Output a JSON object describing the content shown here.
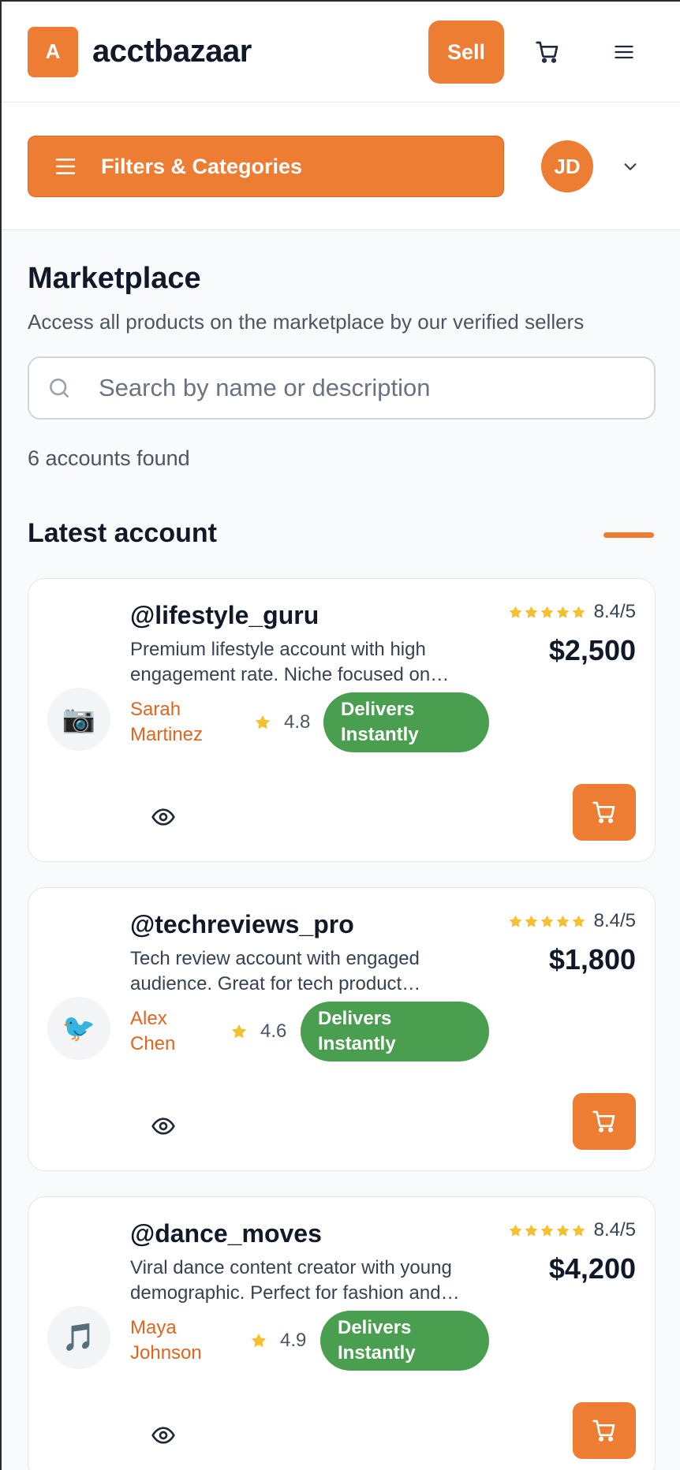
{
  "header": {
    "logo_letter": "A",
    "brand": "acctbazaar",
    "sell_label": "Sell"
  },
  "filterbar": {
    "filters_label": "Filters & Categories",
    "avatar_initials": "JD"
  },
  "main": {
    "title": "Marketplace",
    "subtitle": "Access all products on the marketplace by our verified sellers",
    "search_placeholder": "Search by name or description",
    "count_text": "6 accounts found",
    "section_title": "Latest account"
  },
  "listings": [
    {
      "handle": "@lifestyle_guru",
      "description": "Premium lifestyle account with high engagement rate. Niche focused on…",
      "rating": "8.4/5",
      "price": "$2,500",
      "emoji": "📷",
      "seller": "Sarah Martinez",
      "seller_line1": "Sarah",
      "seller_line2": "Martinez",
      "seller_rating": "4.8",
      "badge": "Delivers Instantly"
    },
    {
      "handle": "@techreviews_pro",
      "description": "Tech review account with engaged audience. Great for tech product…",
      "rating": "8.4/5",
      "price": "$1,800",
      "emoji": "🐦",
      "seller": "Alex Chen",
      "seller_line1": "Alex",
      "seller_line2": "Chen",
      "seller_rating": "4.6",
      "badge": "Delivers Instantly"
    },
    {
      "handle": "@dance_moves",
      "description": "Viral dance content creator with young demographic. Perfect for fashion and…",
      "rating": "8.4/5",
      "price": "$4,200",
      "emoji": "🎵",
      "seller": "Maya Johnson",
      "seller_line1": "Maya",
      "seller_line2": "Johnson",
      "seller_rating": "4.9",
      "badge": "Delivers Instantly"
    }
  ],
  "colors": {
    "accent": "#ed7d32",
    "seller_name": "#e0661f",
    "badge_green": "#4a9e4f",
    "star": "#f5c02b"
  },
  "icons": [
    "cart-icon",
    "menu-icon",
    "chevron-down-icon",
    "search-icon",
    "star-icon",
    "eye-icon"
  ]
}
